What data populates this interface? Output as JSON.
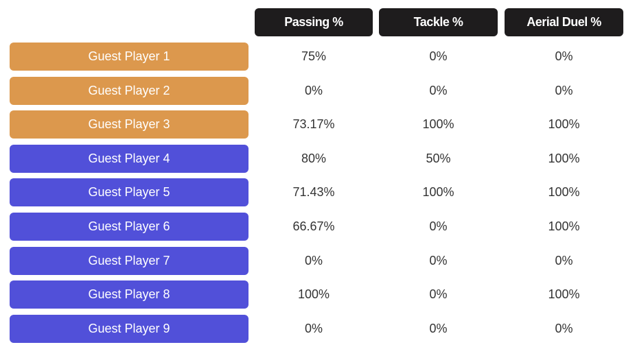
{
  "colors": {
    "header_bg": "#1e1c1d",
    "team_a": "#dc984d",
    "team_b": "#5150d9",
    "text": "#333333"
  },
  "columns": [
    "Passing %",
    "Tackle %",
    "Aerial Duel %"
  ],
  "players": [
    {
      "name": "Guest Player 1",
      "team": "a",
      "passing": "75%",
      "tackle": "0%",
      "aerial": "0%"
    },
    {
      "name": "Guest Player 2",
      "team": "a",
      "passing": "0%",
      "tackle": "0%",
      "aerial": "0%"
    },
    {
      "name": "Guest Player 3",
      "team": "a",
      "passing": "73.17%",
      "tackle": "100%",
      "aerial": "100%"
    },
    {
      "name": "Guest Player 4",
      "team": "b",
      "passing": "80%",
      "tackle": "50%",
      "aerial": "100%"
    },
    {
      "name": "Guest Player 5",
      "team": "b",
      "passing": "71.43%",
      "tackle": "100%",
      "aerial": "100%"
    },
    {
      "name": "Guest Player 6",
      "team": "b",
      "passing": "66.67%",
      "tackle": "0%",
      "aerial": "100%"
    },
    {
      "name": "Guest Player 7",
      "team": "b",
      "passing": "0%",
      "tackle": "0%",
      "aerial": "0%"
    },
    {
      "name": "Guest Player 8",
      "team": "b",
      "passing": "100%",
      "tackle": "0%",
      "aerial": "100%"
    },
    {
      "name": "Guest Player 9",
      "team": "b",
      "passing": "0%",
      "tackle": "0%",
      "aerial": "0%"
    }
  ]
}
